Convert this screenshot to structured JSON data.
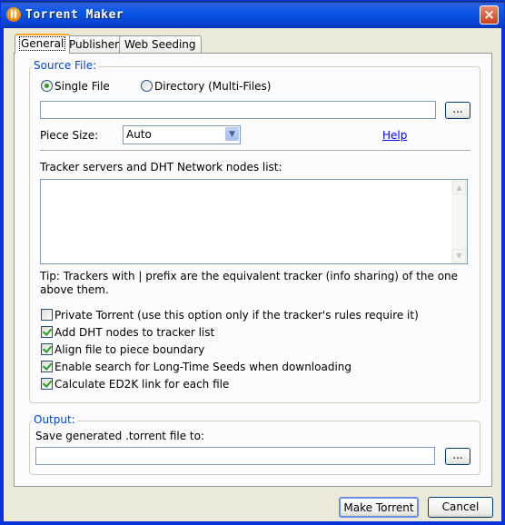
{
  "window": {
    "title": "Torrent Maker",
    "icon": "utorrent-icon",
    "close_glyph": "×"
  },
  "tabs": [
    {
      "label": "General",
      "active": true
    },
    {
      "label": "Publisher",
      "active": false
    },
    {
      "label": "Web Seeding",
      "active": false
    }
  ],
  "source": {
    "group_label": "Source File:",
    "radio_single": "Single File",
    "radio_directory": "Directory (Multi-Files)",
    "selected": "Single File",
    "path_value": "",
    "browse_label": "...",
    "piece_size_label": "Piece Size:",
    "piece_size_value": "Auto",
    "help_label": "Help",
    "trackers_label": "Tracker servers and DHT Network nodes list:",
    "trackers_value": "",
    "tip": "Tip: Trackers with | prefix are the equivalent tracker (info sharing) of the one above them.",
    "options": [
      {
        "label": "Private Torrent (use this option only if the tracker's rules require it)",
        "checked": false
      },
      {
        "label": "Add DHT nodes to tracker list",
        "checked": true
      },
      {
        "label": "Align file to piece boundary",
        "checked": true
      },
      {
        "label": "Enable search for Long-Time Seeds when downloading",
        "checked": true
      },
      {
        "label": "Calculate ED2K link for each file",
        "checked": true
      }
    ]
  },
  "output": {
    "group_label": "Output:",
    "save_label": "Save generated .torrent file to:",
    "path_value": "",
    "browse_label": "..."
  },
  "buttons": {
    "make_torrent": "Make Torrent",
    "cancel": "Cancel"
  },
  "colors": {
    "title_bar": "#0a58e8",
    "group_label": "#0046d5",
    "link": "#0000ff",
    "check": "#21a121"
  }
}
